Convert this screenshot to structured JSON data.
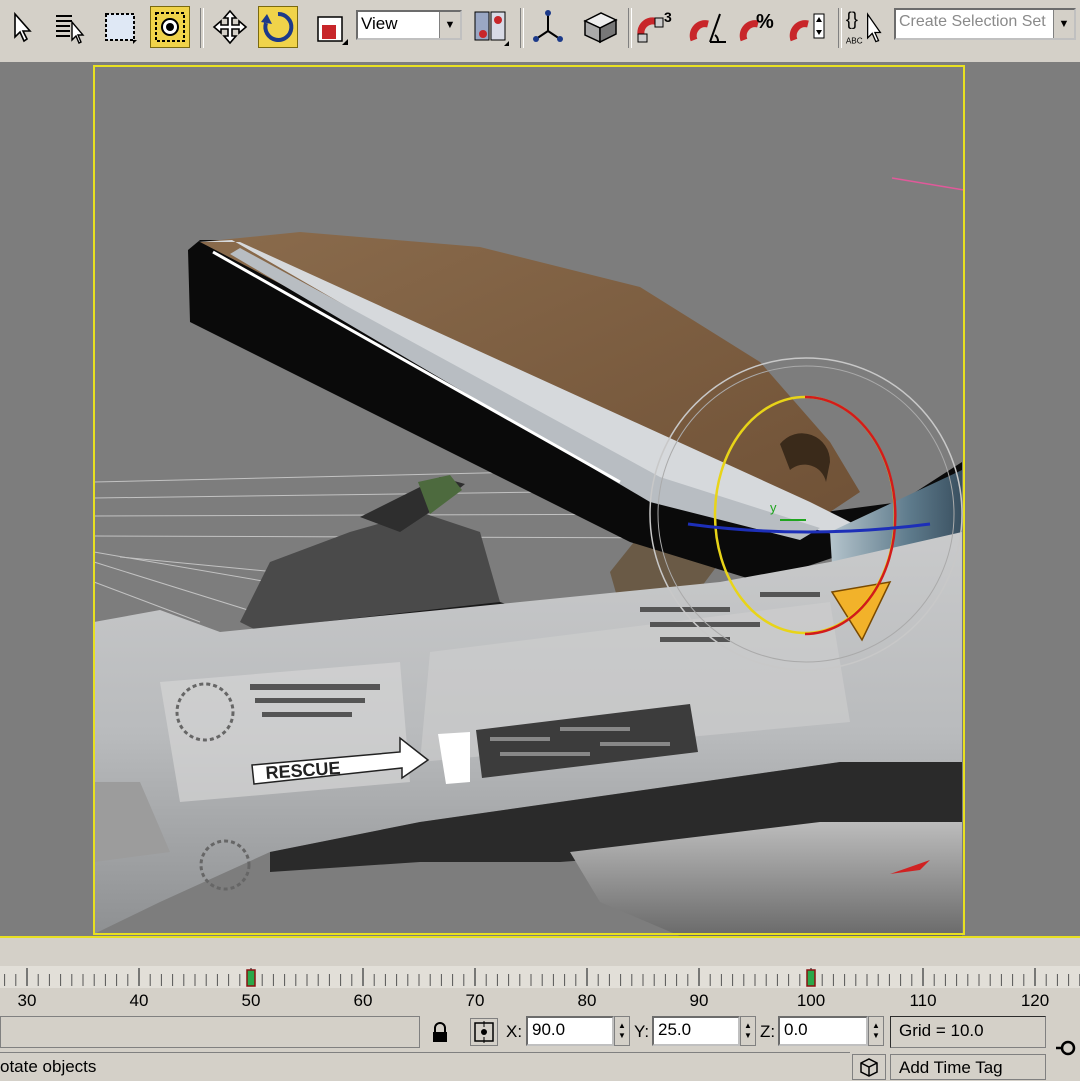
{
  "toolbar": {
    "tools": [
      {
        "name": "select-object-icon"
      },
      {
        "name": "select-by-name-icon"
      },
      {
        "name": "rectangular-selection-icon"
      },
      {
        "name": "window-crossing-icon",
        "active": true
      },
      {
        "name": "move-icon"
      },
      {
        "name": "rotate-icon",
        "active": true
      },
      {
        "name": "scale-icon"
      }
    ],
    "coord_system": "View",
    "selection_set_placeholder": "Create Selection Set",
    "snap_angle_superscript": "3",
    "percent_snap_label": "%",
    "named_sel_label": "ABC"
  },
  "viewport": {
    "decal_text": "RESCUE",
    "gizmo_axis_label": "y",
    "colors": {
      "background": "#7d7d7d",
      "frame": "#e8e020"
    }
  },
  "timeline": {
    "ticks": [
      "30",
      "40",
      "50",
      "60",
      "70",
      "80",
      "90",
      "100",
      "110",
      "120"
    ],
    "keyframes": [
      50,
      100
    ]
  },
  "status": {
    "prompt": "otate objects",
    "x_label": "X:",
    "x_value": "90.0",
    "y_label": "Y:",
    "y_value": "25.0",
    "z_label": "Z:",
    "z_value": "0.0",
    "grid": "Grid = 10.0",
    "add_time_tag": "Add Time Tag"
  }
}
